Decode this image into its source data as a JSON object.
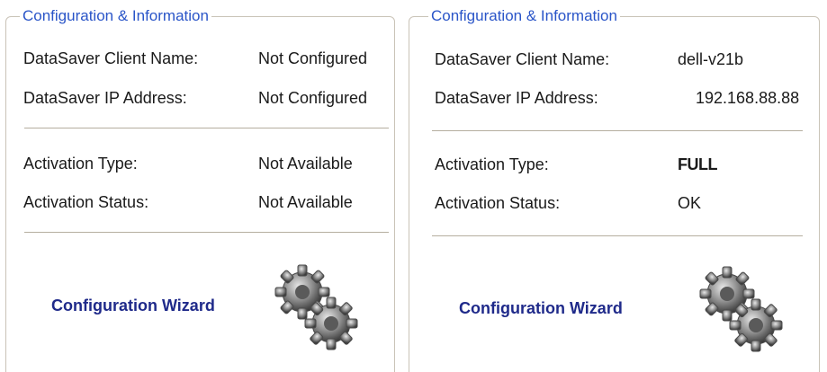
{
  "panels": [
    {
      "legend": "Configuration & Information",
      "client_name_label": "DataSaver Client Name:",
      "client_name_value": "Not Configured",
      "ip_label": "DataSaver IP Address:",
      "ip_value": "Not Configured",
      "activation_type_label": "Activation Type:",
      "activation_type_value": "Not Available",
      "activation_status_label": "Activation Status:",
      "activation_status_value": "Not Available",
      "wizard_label": "Configuration Wizard",
      "wizard_icon": "gears-icon"
    },
    {
      "legend": "Configuration & Information",
      "client_name_label": "DataSaver Client Name:",
      "client_name_value": "dell-v21b",
      "ip_label": "DataSaver IP Address:",
      "ip_value": "192.168.88.88",
      "activation_type_label": "Activation Type:",
      "activation_type_value": "FULL",
      "activation_status_label": "Activation Status:",
      "activation_status_value": "OK",
      "wizard_label": "Configuration Wizard",
      "wizard_icon": "gears-icon"
    }
  ],
  "colors": {
    "legend_text": "#2a55c8",
    "wizard_text": "#1f2a8a",
    "frame_border": "#c9c3b7"
  }
}
